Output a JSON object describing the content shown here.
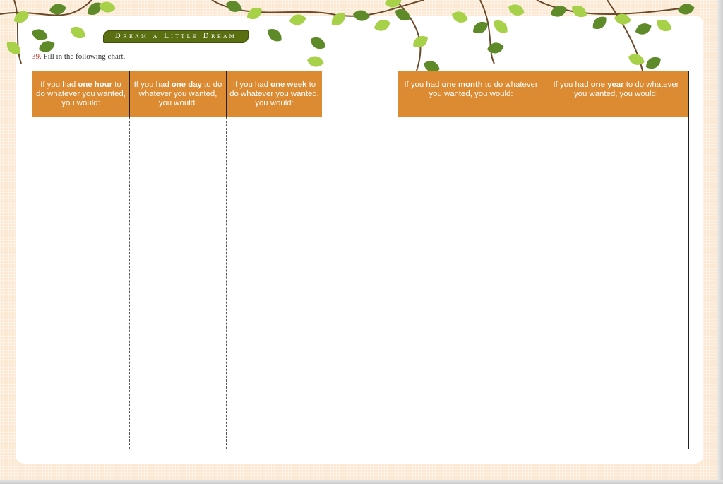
{
  "header": {
    "banner": "Dream a Little Dream"
  },
  "prompt": {
    "number": "39.",
    "text": " Fill in the following chart."
  },
  "left_table": {
    "columns": [
      {
        "pre": "If you had ",
        "bold": "one hour",
        "post": " to do whatever you wanted, you would:"
      },
      {
        "pre": "If you had ",
        "bold": "one day",
        "post": " to do whatever you wanted, you would:"
      },
      {
        "pre": "If you had ",
        "bold": "one week",
        "post": " to do whatever you wanted, you would:"
      }
    ]
  },
  "right_table": {
    "columns": [
      {
        "pre": "If you had ",
        "bold": "one month",
        "post": " to do whatever you wanted, you would:"
      },
      {
        "pre": "If you had ",
        "bold": "one year",
        "post": " to do whatever you wanted, you would:"
      }
    ]
  },
  "colors": {
    "header_orange": "#dc8b32",
    "banner_green": "#5a6f12",
    "leaf_light": "#a8d14a",
    "leaf_dark": "#5f8a2a",
    "background_tan": "#fbe9d3"
  }
}
